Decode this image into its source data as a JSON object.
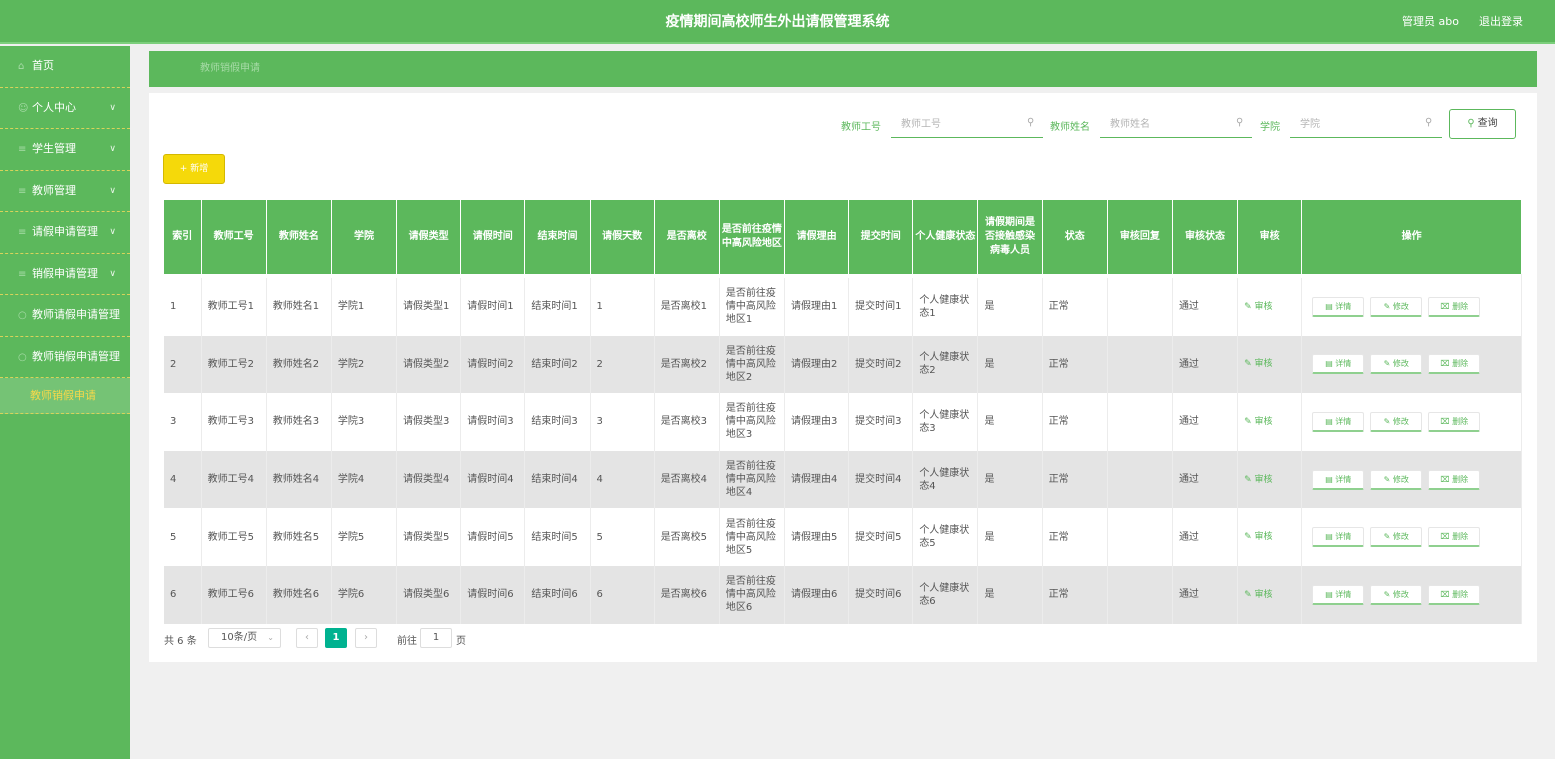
{
  "header": {
    "title": "疫情期间高校师生外出请假管理系统",
    "user_label": "管理员 abo",
    "logout_label": "退出登录"
  },
  "sidebar": {
    "items": [
      {
        "label": "首页",
        "icon": "home-icon",
        "has_children": false
      },
      {
        "label": "个人中心",
        "icon": "user-icon",
        "has_children": true
      },
      {
        "label": "学生管理",
        "icon": "list-icon",
        "has_children": true
      },
      {
        "label": "教师管理",
        "icon": "list-icon",
        "has_children": true
      },
      {
        "label": "请假申请管理",
        "icon": "list-icon",
        "has_children": true
      },
      {
        "label": "销假申请管理",
        "icon": "list-icon",
        "has_children": true
      },
      {
        "label": "教师请假申请管理",
        "icon": "circle-icon",
        "has_children": false
      },
      {
        "label": "教师销假申请管理",
        "icon": "circle-icon",
        "has_children": false
      }
    ],
    "active_sub_item": "教师销假申请"
  },
  "breadcrumb": "教师销假申请",
  "search": {
    "teacher_id_label": "教师工号",
    "teacher_id_placeholder": "教师工号",
    "teacher_name_label": "教师姓名",
    "teacher_name_placeholder": "教师姓名",
    "college_label": "学院",
    "college_placeholder": "学院",
    "query_label": "查询"
  },
  "toolbar": {
    "add_label": "+ 新增"
  },
  "table": {
    "headers": [
      "索引",
      "教师工号",
      "教师姓名",
      "学院",
      "请假类型",
      "请假时间",
      "结束时间",
      "请假天数",
      "是否离校",
      "是否前往疫情中高风险地区",
      "请假理由",
      "提交时间",
      "个人健康状态",
      "请假期间是否接触感染病毒人员",
      "状态",
      "审核回复",
      "审核状态",
      "审核",
      "操作"
    ],
    "rows": [
      {
        "index": "1",
        "teacher_id": "教师工号1",
        "teacher_name": "教师姓名1",
        "college": "学院1",
        "leave_type": "请假类型1",
        "leave_time": "请假时间1",
        "end_time": "结束时间1",
        "days": "1",
        "left_school": "是否离校1",
        "risk_area": "是否前往疫情中高风险地区1",
        "reason": "请假理由1",
        "submit_time": "提交时间1",
        "health": "个人健康状态1",
        "contact": "是",
        "status": "正常",
        "reply": "",
        "audit_status": "通过"
      },
      {
        "index": "2",
        "teacher_id": "教师工号2",
        "teacher_name": "教师姓名2",
        "college": "学院2",
        "leave_type": "请假类型2",
        "leave_time": "请假时间2",
        "end_time": "结束时间2",
        "days": "2",
        "left_school": "是否离校2",
        "risk_area": "是否前往疫情中高风险地区2",
        "reason": "请假理由2",
        "submit_time": "提交时间2",
        "health": "个人健康状态2",
        "contact": "是",
        "status": "正常",
        "reply": "",
        "audit_status": "通过"
      },
      {
        "index": "3",
        "teacher_id": "教师工号3",
        "teacher_name": "教师姓名3",
        "college": "学院3",
        "leave_type": "请假类型3",
        "leave_time": "请假时间3",
        "end_time": "结束时间3",
        "days": "3",
        "left_school": "是否离校3",
        "risk_area": "是否前往疫情中高风险地区3",
        "reason": "请假理由3",
        "submit_time": "提交时间3",
        "health": "个人健康状态3",
        "contact": "是",
        "status": "正常",
        "reply": "",
        "audit_status": "通过"
      },
      {
        "index": "4",
        "teacher_id": "教师工号4",
        "teacher_name": "教师姓名4",
        "college": "学院4",
        "leave_type": "请假类型4",
        "leave_time": "请假时间4",
        "end_time": "结束时间4",
        "days": "4",
        "left_school": "是否离校4",
        "risk_area": "是否前往疫情中高风险地区4",
        "reason": "请假理由4",
        "submit_time": "提交时间4",
        "health": "个人健康状态4",
        "contact": "是",
        "status": "正常",
        "reply": "",
        "audit_status": "通过"
      },
      {
        "index": "5",
        "teacher_id": "教师工号5",
        "teacher_name": "教师姓名5",
        "college": "学院5",
        "leave_type": "请假类型5",
        "leave_time": "请假时间5",
        "end_time": "结束时间5",
        "days": "5",
        "left_school": "是否离校5",
        "risk_area": "是否前往疫情中高风险地区5",
        "reason": "请假理由5",
        "submit_time": "提交时间5",
        "health": "个人健康状态5",
        "contact": "是",
        "status": "正常",
        "reply": "",
        "audit_status": "通过"
      },
      {
        "index": "6",
        "teacher_id": "教师工号6",
        "teacher_name": "教师姓名6",
        "college": "学院6",
        "leave_type": "请假类型6",
        "leave_time": "请假时间6",
        "end_time": "结束时间6",
        "days": "6",
        "left_school": "是否离校6",
        "risk_area": "是否前往疫情中高风险地区6",
        "reason": "请假理由6",
        "submit_time": "提交时间6",
        "health": "个人健康状态6",
        "contact": "是",
        "status": "正常",
        "reply": "",
        "audit_status": "通过"
      }
    ],
    "audit_label": "审核",
    "detail_label": "详情",
    "edit_label": "修改",
    "delete_label": "删除"
  },
  "pagination": {
    "total_label": "共 6 条",
    "page_size": "10条/页",
    "current_page": "1",
    "goto_prefix": "前往",
    "goto_value": "1",
    "goto_suffix": "页"
  },
  "colors": {
    "primary": "#5cb85c",
    "add_button": "#f5d90a",
    "active_menu_text": "#f6d84a",
    "current_page": "#00b290"
  }
}
